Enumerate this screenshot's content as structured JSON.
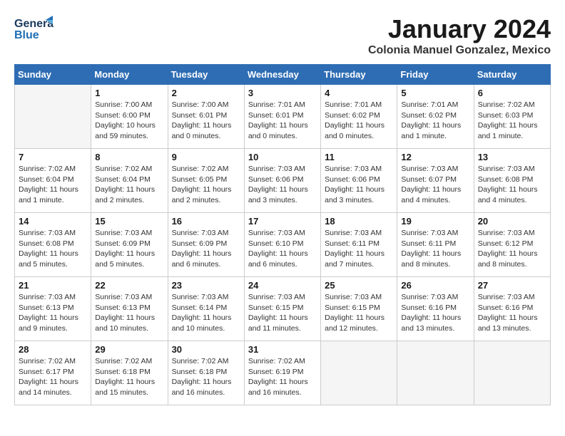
{
  "header": {
    "logo_general": "General",
    "logo_blue": "Blue",
    "month_title": "January 2024",
    "location": "Colonia Manuel Gonzalez, Mexico"
  },
  "weekdays": [
    "Sunday",
    "Monday",
    "Tuesday",
    "Wednesday",
    "Thursday",
    "Friday",
    "Saturday"
  ],
  "weeks": [
    [
      {
        "day": "",
        "sunrise": "",
        "sunset": "",
        "daylight": ""
      },
      {
        "day": "1",
        "sunrise": "Sunrise: 7:00 AM",
        "sunset": "Sunset: 6:00 PM",
        "daylight": "Daylight: 10 hours and 59 minutes."
      },
      {
        "day": "2",
        "sunrise": "Sunrise: 7:00 AM",
        "sunset": "Sunset: 6:01 PM",
        "daylight": "Daylight: 11 hours and 0 minutes."
      },
      {
        "day": "3",
        "sunrise": "Sunrise: 7:01 AM",
        "sunset": "Sunset: 6:01 PM",
        "daylight": "Daylight: 11 hours and 0 minutes."
      },
      {
        "day": "4",
        "sunrise": "Sunrise: 7:01 AM",
        "sunset": "Sunset: 6:02 PM",
        "daylight": "Daylight: 11 hours and 0 minutes."
      },
      {
        "day": "5",
        "sunrise": "Sunrise: 7:01 AM",
        "sunset": "Sunset: 6:02 PM",
        "daylight": "Daylight: 11 hours and 1 minute."
      },
      {
        "day": "6",
        "sunrise": "Sunrise: 7:02 AM",
        "sunset": "Sunset: 6:03 PM",
        "daylight": "Daylight: 11 hours and 1 minute."
      }
    ],
    [
      {
        "day": "7",
        "sunrise": "Sunrise: 7:02 AM",
        "sunset": "Sunset: 6:04 PM",
        "daylight": "Daylight: 11 hours and 1 minute."
      },
      {
        "day": "8",
        "sunrise": "Sunrise: 7:02 AM",
        "sunset": "Sunset: 6:04 PM",
        "daylight": "Daylight: 11 hours and 2 minutes."
      },
      {
        "day": "9",
        "sunrise": "Sunrise: 7:02 AM",
        "sunset": "Sunset: 6:05 PM",
        "daylight": "Daylight: 11 hours and 2 minutes."
      },
      {
        "day": "10",
        "sunrise": "Sunrise: 7:03 AM",
        "sunset": "Sunset: 6:06 PM",
        "daylight": "Daylight: 11 hours and 3 minutes."
      },
      {
        "day": "11",
        "sunrise": "Sunrise: 7:03 AM",
        "sunset": "Sunset: 6:06 PM",
        "daylight": "Daylight: 11 hours and 3 minutes."
      },
      {
        "day": "12",
        "sunrise": "Sunrise: 7:03 AM",
        "sunset": "Sunset: 6:07 PM",
        "daylight": "Daylight: 11 hours and 4 minutes."
      },
      {
        "day": "13",
        "sunrise": "Sunrise: 7:03 AM",
        "sunset": "Sunset: 6:08 PM",
        "daylight": "Daylight: 11 hours and 4 minutes."
      }
    ],
    [
      {
        "day": "14",
        "sunrise": "Sunrise: 7:03 AM",
        "sunset": "Sunset: 6:08 PM",
        "daylight": "Daylight: 11 hours and 5 minutes."
      },
      {
        "day": "15",
        "sunrise": "Sunrise: 7:03 AM",
        "sunset": "Sunset: 6:09 PM",
        "daylight": "Daylight: 11 hours and 5 minutes."
      },
      {
        "day": "16",
        "sunrise": "Sunrise: 7:03 AM",
        "sunset": "Sunset: 6:09 PM",
        "daylight": "Daylight: 11 hours and 6 minutes."
      },
      {
        "day": "17",
        "sunrise": "Sunrise: 7:03 AM",
        "sunset": "Sunset: 6:10 PM",
        "daylight": "Daylight: 11 hours and 6 minutes."
      },
      {
        "day": "18",
        "sunrise": "Sunrise: 7:03 AM",
        "sunset": "Sunset: 6:11 PM",
        "daylight": "Daylight: 11 hours and 7 minutes."
      },
      {
        "day": "19",
        "sunrise": "Sunrise: 7:03 AM",
        "sunset": "Sunset: 6:11 PM",
        "daylight": "Daylight: 11 hours and 8 minutes."
      },
      {
        "day": "20",
        "sunrise": "Sunrise: 7:03 AM",
        "sunset": "Sunset: 6:12 PM",
        "daylight": "Daylight: 11 hours and 8 minutes."
      }
    ],
    [
      {
        "day": "21",
        "sunrise": "Sunrise: 7:03 AM",
        "sunset": "Sunset: 6:13 PM",
        "daylight": "Daylight: 11 hours and 9 minutes."
      },
      {
        "day": "22",
        "sunrise": "Sunrise: 7:03 AM",
        "sunset": "Sunset: 6:13 PM",
        "daylight": "Daylight: 11 hours and 10 minutes."
      },
      {
        "day": "23",
        "sunrise": "Sunrise: 7:03 AM",
        "sunset": "Sunset: 6:14 PM",
        "daylight": "Daylight: 11 hours and 10 minutes."
      },
      {
        "day": "24",
        "sunrise": "Sunrise: 7:03 AM",
        "sunset": "Sunset: 6:15 PM",
        "daylight": "Daylight: 11 hours and 11 minutes."
      },
      {
        "day": "25",
        "sunrise": "Sunrise: 7:03 AM",
        "sunset": "Sunset: 6:15 PM",
        "daylight": "Daylight: 11 hours and 12 minutes."
      },
      {
        "day": "26",
        "sunrise": "Sunrise: 7:03 AM",
        "sunset": "Sunset: 6:16 PM",
        "daylight": "Daylight: 11 hours and 13 minutes."
      },
      {
        "day": "27",
        "sunrise": "Sunrise: 7:03 AM",
        "sunset": "Sunset: 6:16 PM",
        "daylight": "Daylight: 11 hours and 13 minutes."
      }
    ],
    [
      {
        "day": "28",
        "sunrise": "Sunrise: 7:02 AM",
        "sunset": "Sunset: 6:17 PM",
        "daylight": "Daylight: 11 hours and 14 minutes."
      },
      {
        "day": "29",
        "sunrise": "Sunrise: 7:02 AM",
        "sunset": "Sunset: 6:18 PM",
        "daylight": "Daylight: 11 hours and 15 minutes."
      },
      {
        "day": "30",
        "sunrise": "Sunrise: 7:02 AM",
        "sunset": "Sunset: 6:18 PM",
        "daylight": "Daylight: 11 hours and 16 minutes."
      },
      {
        "day": "31",
        "sunrise": "Sunrise: 7:02 AM",
        "sunset": "Sunset: 6:19 PM",
        "daylight": "Daylight: 11 hours and 16 minutes."
      },
      {
        "day": "",
        "sunrise": "",
        "sunset": "",
        "daylight": ""
      },
      {
        "day": "",
        "sunrise": "",
        "sunset": "",
        "daylight": ""
      },
      {
        "day": "",
        "sunrise": "",
        "sunset": "",
        "daylight": ""
      }
    ]
  ]
}
